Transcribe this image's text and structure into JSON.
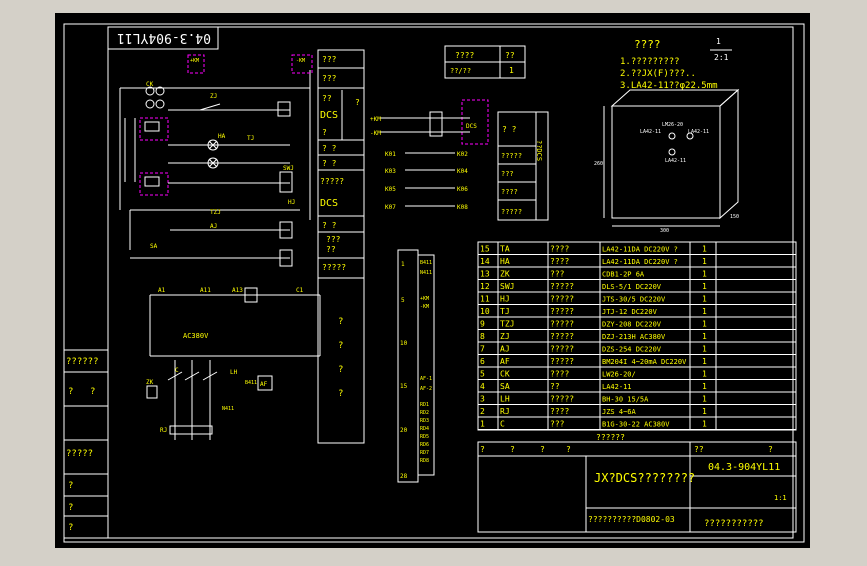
{
  "drawing_no": "04.3-904YL11",
  "drawing_no_block": "04.3-904YL11",
  "title_main": "JX?DCS????????",
  "title_sub": "??????????D0802-03",
  "title_company": "???????????",
  "scale": "1:1",
  "sheet_fraction": {
    "top": "1",
    "bottom": "2:1"
  },
  "notes": {
    "heading": "????",
    "line1": "1.?????????",
    "line2": "2.??JX(F)???..",
    "line3": "3.LA42-11??φ22.5mm"
  },
  "detail_labels": {
    "lm": "LM26-20",
    "la1": "LA42-11",
    "la2": "LA42-11",
    "la3": "LA42-11",
    "dim_h": "260",
    "dim_w": "300",
    "dim_d": "150"
  },
  "small_table": {
    "r1": [
      "????",
      "??"
    ],
    "r2": [
      "??/??",
      "1"
    ]
  },
  "parts": [
    {
      "no": "15",
      "code": "TA",
      "name": "????",
      "model": "LA42-11DA DC220V ?",
      "qty": "1"
    },
    {
      "no": "14",
      "code": "HA",
      "name": "????",
      "model": "LA42-11DA DC220V ?",
      "qty": "1"
    },
    {
      "no": "13",
      "code": "ZK",
      "name": "???",
      "model": "CDB1-2P 6A",
      "qty": "1"
    },
    {
      "no": "12",
      "code": "SWJ",
      "name": "?????",
      "model": "DLS-5/1 DC220V",
      "qty": "1"
    },
    {
      "no": "11",
      "code": "HJ",
      "name": "?????",
      "model": "JTS-30/5 DC220V",
      "qty": "1"
    },
    {
      "no": "10",
      "code": "TJ",
      "name": "?????",
      "model": "JTJ-12 DC220V",
      "qty": "1"
    },
    {
      "no": "9",
      "code": "TZJ",
      "name": "?????",
      "model": "DZY-208 DC220V",
      "qty": "1"
    },
    {
      "no": "8",
      "code": "ZJ",
      "name": "?????",
      "model": "DZJ-213H AC380V",
      "qty": "1"
    },
    {
      "no": "7",
      "code": "AJ",
      "name": "?????",
      "model": "DZS-254 DC220V",
      "qty": "1"
    },
    {
      "no": "6",
      "code": "AF",
      "name": "?????",
      "model": "BM204I 4~20mA DC220V",
      "qty": "1"
    },
    {
      "no": "5",
      "code": "CK",
      "name": "????",
      "model": "LW26-20/",
      "qty": "1"
    },
    {
      "no": "4",
      "code": "SA",
      "name": "??",
      "model": "LA42-11",
      "qty": "1"
    },
    {
      "no": "3",
      "code": "LH",
      "name": "?????",
      "model": "BH-30 15/5A",
      "qty": "1"
    },
    {
      "no": "2",
      "code": "RJ",
      "name": "????",
      "model": "JZS 4~6A",
      "qty": "1"
    },
    {
      "no": "1",
      "code": "C",
      "name": "???",
      "model": "B1G-30-22 AC380V",
      "qty": "1"
    }
  ],
  "parts_footer": "??????",
  "parts_header": [
    "??",
    "?",
    "?",
    "?",
    "??",
    "?",
    "?",
    "??",
    "?",
    "?"
  ],
  "mid_panel": {
    "r1": "???",
    "r2": "???",
    "r3": "??",
    "r4": "DCS",
    "r5": "?",
    "r6": "? ?",
    "r7": "? ?",
    "r8": "?????",
    "r9": "DCS",
    "r10": "? ?",
    "r11": "???",
    "r12": "??",
    "r13": "?????",
    "r14": "?",
    "r15": "?",
    "r16": "?",
    "r17": "?",
    "side": "?"
  },
  "dcs_panel": {
    "r1": "? ?",
    "r2": "?????",
    "r3": "???",
    "r4": "????",
    "r5": "?????",
    "side": "??DCS"
  },
  "terminal_labels": {
    "t1": "B411",
    "t2": "N411",
    "t3": "+KM",
    "t4": "-KM",
    "t5": "AF-1",
    "t6": "AF-2",
    "t7": "RD1",
    "t8": "RD2",
    "t9": "RD3",
    "t10": "RD4",
    "t11": "RD5",
    "t12": "RD6",
    "t13": "RD7",
    "t14": "RD8",
    "n1": "1",
    "n5": "5",
    "n10": "10",
    "n15": "15",
    "n20": "20",
    "n28": "28"
  },
  "circuit_labels": {
    "ck": "CK",
    "zj": "ZJ",
    "ha": "HA",
    "tj": "TJ",
    "swj": "SWJ",
    "hj": "HJ",
    "tzj": "TZJ",
    "aj": "AJ",
    "sa": "SA",
    "ac": "AC380V",
    "a1": "A1",
    "a11": "A11",
    "a13": "A13",
    "c1": "C1",
    "lh": "LH",
    "b411": "B411",
    "n411": "N411",
    "zk": "ZK",
    "af": "AF",
    "rj": "RJ",
    "c": "C",
    "km_p": "+KM",
    "km_n": "-KM",
    "dcs": "DCS"
  },
  "io_labels": [
    "K01",
    "K02",
    "K03",
    "K04",
    "K05",
    "K06",
    "K07",
    "K08"
  ],
  "left_side": [
    "??????",
    "?",
    "?",
    "?????",
    "?",
    "?",
    "?"
  ],
  "title_cells": {
    "a": "?",
    "b": "?",
    "c": "?",
    "d": "?",
    "e": "??",
    "f": "?"
  }
}
